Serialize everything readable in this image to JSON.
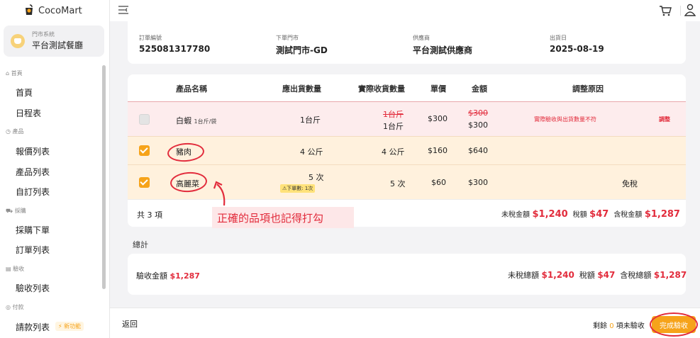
{
  "app": {
    "name": "CocoMart"
  },
  "store": {
    "system_label": "門市系統",
    "name": "平台測試餐廳"
  },
  "sidebar": {
    "sections": [
      {
        "label": "首頁",
        "icon": "home-icon",
        "items": [
          "首頁",
          "日程表"
        ]
      },
      {
        "label": "產品",
        "icon": "box-icon",
        "items": [
          "報價列表",
          "產品列表",
          "自訂列表"
        ]
      },
      {
        "label": "採購",
        "icon": "cart-icon",
        "items": [
          "採購下單",
          "訂單列表"
        ]
      },
      {
        "label": "驗收",
        "icon": "check-icon",
        "items": [
          "驗收列表"
        ]
      },
      {
        "label": "付款",
        "icon": "coin-icon",
        "items": [
          "請款列表"
        ]
      }
    ],
    "new_badge": "新功能"
  },
  "order_info": {
    "order_no_label": "訂單編號",
    "order_no": "525081317780",
    "store_label": "下單門市",
    "store": "測試門市-GD",
    "supplier_label": "供應商",
    "supplier": "平台測試供應商",
    "ship_date_label": "出貨日",
    "ship_date": "2025-08-19"
  },
  "table": {
    "headers": [
      "產品名稱",
      "應出貨數量",
      "實際收貨數量",
      "單價",
      "金額",
      "調整原因"
    ],
    "rows": [
      {
        "name": "白蝦",
        "spec": "1台斤/袋",
        "ship_qty": "1台斤",
        "recv_qty_old": "1台斤",
        "recv_qty": "1台斤",
        "price": "$300",
        "amount_old": "$300",
        "amount": "$300",
        "reason": "實際驗收與出貨數量不符",
        "action": "調整",
        "checked": false,
        "disabled": true
      },
      {
        "name": "豬肉",
        "ship_qty": "4 公斤",
        "recv_qty": "4 公斤",
        "price": "$160",
        "amount": "$640",
        "checked": true
      },
      {
        "name": "高麗菜",
        "ship_qty": "5 次",
        "warning": "⚠下單數: 1次",
        "recv_qty": "5 次",
        "price": "$60",
        "amount": "$300",
        "reason": "免稅",
        "checked": true
      }
    ],
    "footer": {
      "count": "共 3 項",
      "pretax_label": "未稅金額",
      "pretax": "$1,240",
      "tax_label": "稅額",
      "tax": "$47",
      "total_label": "含稅金額",
      "total": "$1,287"
    }
  },
  "annotation": "正確的品項也記得打勾",
  "summary": {
    "title": "總計",
    "accept_label": "驗收金額",
    "accept_amount": "$1,287",
    "pretax_label": "未稅總額",
    "pretax": "$1,240",
    "tax_label": "稅額",
    "tax": "$47",
    "total_label": "含稅總額",
    "total": "$1,287"
  },
  "bottom": {
    "back": "返回",
    "remaining_prefix": "剩餘",
    "remaining_count": "0",
    "remaining_suffix": "項未驗收",
    "complete": "完成驗收"
  },
  "colors": {
    "accent": "#f6a31a",
    "danger": "#e22c3c"
  }
}
